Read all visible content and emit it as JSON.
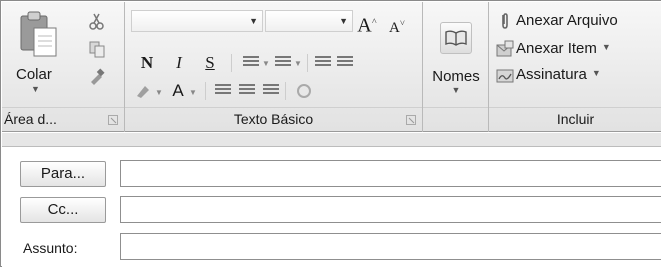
{
  "ribbon": {
    "clipboard": {
      "paste_label": "Colar",
      "group_label": "Área d..."
    },
    "basic_text": {
      "group_label": "Texto Básico",
      "bold": "N",
      "italic": "I",
      "underline": "S",
      "font_color": "A"
    },
    "names": {
      "label": "Nomes"
    },
    "include": {
      "group_label": "Incluir",
      "attach_file": "Anexar Arquivo",
      "attach_item": "Anexar Item",
      "signature": "Assinatura"
    }
  },
  "compose": {
    "to_button": "Para...",
    "cc_button": "Cc...",
    "subject_label": "Assunto:",
    "to_value": "",
    "cc_value": "",
    "subject_value": ""
  }
}
